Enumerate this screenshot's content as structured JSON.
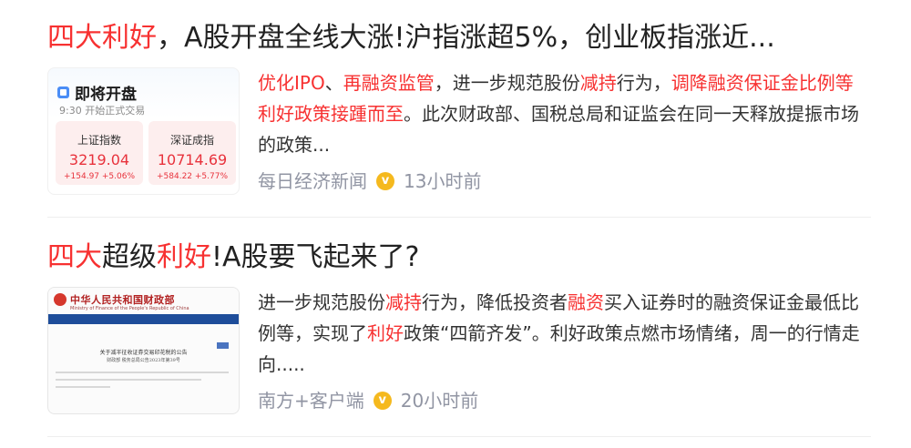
{
  "results": [
    {
      "title_parts": [
        {
          "text": "四大利好",
          "hl": true
        },
        {
          "text": "，A股开盘全线大涨!沪指涨超5%，创业板指涨近...",
          "hl": false
        }
      ],
      "snippet_parts": [
        {
          "text": "优化IPO",
          "hl": true
        },
        {
          "text": "、",
          "hl": false
        },
        {
          "text": "再融资监管",
          "hl": true
        },
        {
          "text": "，进一步规范股份",
          "hl": false
        },
        {
          "text": "减持",
          "hl": true
        },
        {
          "text": "行为，",
          "hl": false
        },
        {
          "text": "调降融资保证金比例等利好政策接踵而至",
          "hl": true
        },
        {
          "text": "。此次财政部、国税总局和证监会在同一天释放提振市场的政策...",
          "hl": false
        }
      ],
      "source": "每日经济新闻",
      "verified_icon": "verified-v-icon",
      "time": "13小时前",
      "thumbnail": {
        "heading": "即将开盘",
        "subheading": "9:30 开始正式交易",
        "boxes": [
          {
            "name": "上证指数",
            "value": "3219.04",
            "change": "+154.97  +5.06%"
          },
          {
            "name": "深证成指",
            "value": "10714.69",
            "change": "+584.22  +5.77%"
          }
        ]
      }
    },
    {
      "title_parts": [
        {
          "text": "四大",
          "hl": true
        },
        {
          "text": "超级",
          "hl": false
        },
        {
          "text": "利好",
          "hl": true
        },
        {
          "text": "!A股要飞起来了?",
          "hl": false
        }
      ],
      "snippet_parts": [
        {
          "text": "进一步规范股份",
          "hl": false
        },
        {
          "text": "减持",
          "hl": true
        },
        {
          "text": "行为，降低投资者",
          "hl": false
        },
        {
          "text": "融资",
          "hl": true
        },
        {
          "text": "买入证券时的融资保证金最低比例等，实现了",
          "hl": false
        },
        {
          "text": "利好",
          "hl": true
        },
        {
          "text": "政策“四箭齐发”。利好政策点燃市场情绪，周一的行情走向.....",
          "hl": false
        }
      ],
      "source": "南方+客户端",
      "verified_icon": "verified-v-icon",
      "time": "20小时前",
      "thumbnail": {
        "site_name": "中华人民共和国财政部",
        "site_name_en": "Ministry of Finance of the People's Republic of China",
        "doc_title": "关于减半征收证券交易印花税的公告",
        "doc_sub": "财政部 税务总局公告2023年第39号"
      }
    }
  ],
  "colors": {
    "highlight": "#f73131",
    "text": "#222222",
    "meta": "#9195a3",
    "badge": "#f5b91e"
  }
}
